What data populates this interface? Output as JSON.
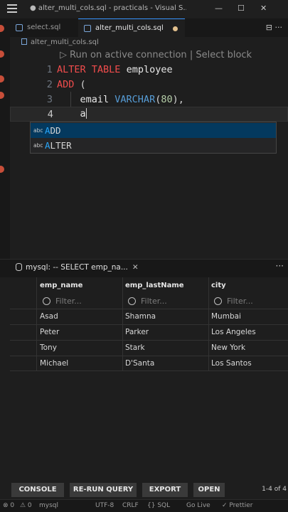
{
  "window": {
    "title": "● alter_multi_cols.sql - practicals - Visual S...",
    "minimize": "—",
    "maximize": "☐",
    "close": "✕"
  },
  "tabs": [
    {
      "label": "select.sql",
      "active": false
    },
    {
      "label": "alter_multi_cols.sql",
      "active": true,
      "modified": true
    }
  ],
  "editor_actions": "⊟ ···",
  "breadcrumb": "alter_multi_cols.sql",
  "codelens": {
    "run": "Run on active connection",
    "separator": "|",
    "select": "Select block"
  },
  "lines": [
    {
      "num": "1",
      "text": "ALTER TABLE employee"
    },
    {
      "num": "2",
      "text": "ADD ("
    },
    {
      "num": "3",
      "text": "    email VARCHAR(80),"
    },
    {
      "num": "4",
      "text": "    a"
    }
  ],
  "suggest": {
    "items": [
      {
        "icon": "abc",
        "label": "ADD",
        "selected": true
      },
      {
        "icon": "abc",
        "label": "ALTER",
        "selected": false
      }
    ]
  },
  "panel": {
    "tab_label": "mysql: -- SELECT emp_na...",
    "close": "✕",
    "more": "···"
  },
  "results": {
    "columns": [
      "emp_name",
      "emp_lastName",
      "city"
    ],
    "filter_placeholder": "Filter...",
    "rows": [
      [
        "Asad",
        "Shamna",
        "Mumbai"
      ],
      [
        "Peter",
        "Parker",
        "Los Angeles"
      ],
      [
        "Tony",
        "Stark",
        "New York"
      ],
      [
        "Michael",
        "D'Santa",
        "Los Santos"
      ]
    ]
  },
  "buttons": {
    "console": "CONSOLE",
    "rerun": "RE-RUN QUERY",
    "export": "EXPORT",
    "open": "OPEN",
    "pager": "1-4 of 4"
  },
  "statusbar": {
    "errors": "⊗ 0",
    "warnings": "⚠ 0",
    "connection": "mysql",
    "encoding": "UTF-8",
    "eol": "CRLF",
    "language": "{} SQL",
    "golive": "Go Live",
    "prettier": "✓ Prettier"
  },
  "colors": {
    "accent": "#3794ff",
    "keyword": "#f14c4c",
    "type": "#569cd6",
    "number": "#b5cea8",
    "modified_dot": "#e2c08d",
    "suggest_selected": "#04395e"
  }
}
